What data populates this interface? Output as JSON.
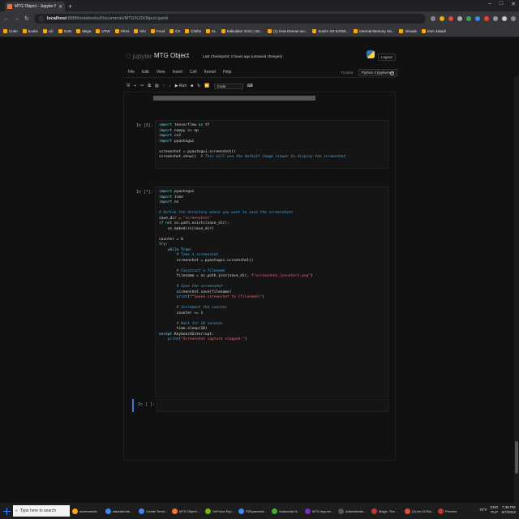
{
  "browser": {
    "tab_title": "MTG Object - Jupyter Notebook",
    "new_tab": "+",
    "url_host": "localhost",
    "url_rest": ":8888/notebooks/Documents/MTG%20Object.ipynb",
    "bookmarks": [
      "Code",
      "books",
      "Lib",
      "SUN",
      "Maya",
      "UTW",
      "Films",
      "Info",
      "Food",
      "CS",
      "Cloths",
      "KL",
      "Kalkulator SUS | UD...",
      "(1) How Denver wo...",
      "Sonim XS-54760...",
      "Internal Memory Ha...",
      "Visuals",
      "Imm Jakadi"
    ]
  },
  "jupyter": {
    "logo_text": "jupyter",
    "notebook_name": "MTG Object",
    "checkpoint": "Last Checkpoint: 2 hours ago  (unsaved changes)",
    "logout": "Logout",
    "trusted": "Trusted",
    "kernel": "Python 3 (ipykernel)",
    "menus": [
      "File",
      "Edit",
      "View",
      "Insert",
      "Cell",
      "Kernel",
      "Help"
    ],
    "run_label": "Run",
    "cell_type": "Code"
  },
  "cells": [
    {
      "prompt": "In [6]:",
      "lines": [
        "import tensorflow as tf",
        "import numpy as np",
        "import cv2",
        "import pyautogui",
        "",
        "screenshot = pyautogui.screenshot()",
        "screenshot.show()  # This will use the default image viewer to display the screenshot"
      ]
    },
    {
      "prompt": "In [*]:",
      "lines": [
        "import pyautogui",
        "import time",
        "import os",
        "",
        "# Define the directory where you want to save the screenshots",
        "save_dir = \"screenshots\"",
        "if not os.path.exists(save_dir):",
        "    os.makedirs(save_dir)",
        "",
        "counter = 0",
        "try:",
        "    while True:",
        "        # Take a screenshot",
        "        screenshot = pyautogui.screenshot()",
        "",
        "        # Construct a filename",
        "        filename = os.path.join(save_dir, f\"screenshot_{counter}.png\")",
        "",
        "        # Save the screenshot",
        "        screenshot.save(filename)",
        "        print(f\"Saved screenshot to {filename}\")",
        "",
        "        # Increment the counter",
        "        counter += 1",
        "",
        "        # Wait for 10 seconds",
        "        time.sleep(10)",
        "except KeyboardInterrupt:",
        "    print(\"Screenshot capture stopped.\")"
      ]
    },
    {
      "prompt": "In [ ]:",
      "lines": [
        ""
      ]
    }
  ],
  "taskbar": {
    "search_placeholder": "Type here to search",
    "apps": [
      "screenshots",
      "standard.de...",
      "Create Termi...",
      "MTG Object ...",
      "GeForce Exp...",
      "PZEyamsrwi...",
      "Anaconda N...",
      "MTG.img rec...",
      "Administrato...",
      "Magic: The ...",
      "(3) ew 13 Sla...",
      "Preview"
    ],
    "weather": "70°F",
    "lang": "ENG",
    "lang2": "PLP",
    "time": "7:38 PM",
    "date": "9/7/2023"
  }
}
